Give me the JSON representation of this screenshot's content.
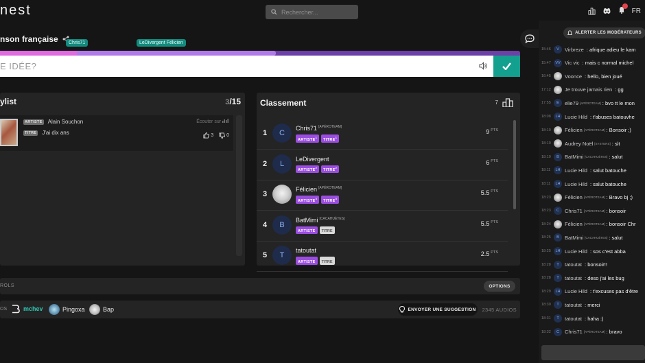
{
  "header": {
    "logo": "nest",
    "search_placeholder": "Rechercher...",
    "language": "FR"
  },
  "room": {
    "title": "nson française",
    "progress_fraction": 0.53,
    "player_tags": [
      "Chris71",
      "LeDivergent Félicien"
    ]
  },
  "answer": {
    "placeholder": "E IDÉE?"
  },
  "playlist": {
    "title": "ylist",
    "count_current": "3",
    "count_total": "/15",
    "song": {
      "artist_badge": "ARTISTE",
      "artist": "Alain Souchon",
      "title_badge": "TITRE",
      "title": "J'ai dix ans",
      "listen": "Écouter sur",
      "likes": "3",
      "dislikes": "0"
    }
  },
  "ranking": {
    "title": "Classement",
    "count": "7",
    "pts_label": "PTS",
    "rows": [
      {
        "rank": "1",
        "initial": "C",
        "name": "Chris71",
        "team": "[APÉROTEAM]",
        "badges": [
          {
            "label": "ARTISTE",
            "sup": "1",
            "active": true
          },
          {
            "label": "TITRE",
            "sup": "1",
            "active": true
          }
        ],
        "points": "9",
        "photo": false
      },
      {
        "rank": "2",
        "initial": "L",
        "name": "LeDivergent",
        "team": "",
        "badges": [
          {
            "label": "ARTISTE",
            "sup": "2",
            "active": true
          },
          {
            "label": "TITRE",
            "sup": "2",
            "active": true
          }
        ],
        "points": "6",
        "photo": false
      },
      {
        "rank": "3",
        "initial": "",
        "name": "Félicien",
        "team": "[APÉROTEAM]",
        "badges": [
          {
            "label": "ARTISTE",
            "sup": "3",
            "active": true
          },
          {
            "label": "TITRE",
            "sup": "3",
            "active": true
          }
        ],
        "points": "5.5",
        "photo": true
      },
      {
        "rank": "4",
        "initial": "B",
        "name": "BatMimi",
        "team": "[CACAHUÈTES]",
        "badges": [
          {
            "label": "ARTISTE",
            "sup": "",
            "active": true
          },
          {
            "label": "TITRE",
            "sup": "",
            "active": false
          }
        ],
        "points": "5.5",
        "photo": false
      },
      {
        "rank": "5",
        "initial": "T",
        "name": "tatoutat",
        "team": "",
        "badges": [
          {
            "label": "ARTISTE",
            "sup": "",
            "active": true
          },
          {
            "label": "TITRE",
            "sup": "",
            "active": false
          }
        ],
        "points": "2.5",
        "photo": false
      }
    ]
  },
  "bottom": {
    "controls_label": "ROLS",
    "options": "OPTIONS",
    "players_lead": "OS",
    "players": [
      "mchev",
      "Pingoxa",
      "Bap"
    ],
    "suggest": "ENVOYER UNE SUGGESTION",
    "audios": "2345 AUDIOS"
  },
  "chat": {
    "alert": "ALERTER LES MODÉRATEURS",
    "messages": [
      {
        "time": "15:46",
        "initial": "V",
        "user": "Virbreze",
        "team": "",
        "text": "afrique adieu le kam",
        "photo": false
      },
      {
        "time": "15:47",
        "initial": "VV",
        "user": "Vic vic",
        "team": "",
        "text": "mais c normal michel",
        "photo": false
      },
      {
        "time": "16:45",
        "initial": "",
        "user": "Voonce",
        "team": "",
        "text": "hello, bien joué",
        "photo": true
      },
      {
        "time": "17:12",
        "initial": "",
        "user": "Je trouve jamais rien",
        "team": "",
        "text": "gg",
        "photo": true
      },
      {
        "time": "17:55",
        "initial": "E",
        "user": "elie79",
        "team": "[APÉROTEAM]",
        "text": "bvo tt le mon",
        "photo": false
      },
      {
        "time": "18:08",
        "initial": "LH",
        "user": "Lucie Hild",
        "team": "",
        "text": "t'abuses batouvhe",
        "photo": false
      },
      {
        "time": "18:10",
        "initial": "",
        "user": "Félicien",
        "team": "[APÉROTEAM]",
        "text": "Bonsoir ;)",
        "photo": true
      },
      {
        "time": "18:10",
        "initial": "",
        "user": "Audrey Noël",
        "team": "[SYSTERS]",
        "text": "slt",
        "photo": true
      },
      {
        "time": "18:10",
        "initial": "B",
        "user": "BatMimi",
        "team": "[CACAHUÈTES]",
        "text": "salut",
        "photo": false
      },
      {
        "time": "18:11",
        "initial": "LH",
        "user": "Lucie Hild",
        "team": "",
        "text": "salut batouche",
        "photo": false
      },
      {
        "time": "18:11",
        "initial": "LH",
        "user": "Lucie Hild",
        "team": "",
        "text": "salut batouche",
        "photo": false
      },
      {
        "time": "18:23",
        "initial": "",
        "user": "Félicien",
        "team": "[APÉROTEAM]",
        "text": "Bravo bj ;)",
        "photo": true
      },
      {
        "time": "18:23",
        "initial": "C",
        "user": "Chris71",
        "team": "[APÉROTEAM]",
        "text": "bonsoir",
        "photo": false
      },
      {
        "time": "18:24",
        "initial": "",
        "user": "Félicien",
        "team": "[APÉROTEAM]",
        "text": "bonsoir Chr",
        "photo": true
      },
      {
        "time": "18:25",
        "initial": "B",
        "user": "BatMimi",
        "team": "[CACAHUÈTES]",
        "text": "salut",
        "photo": false
      },
      {
        "time": "18:25",
        "initial": "LH",
        "user": "Lucie Hild",
        "team": "",
        "text": "sos c'est abba",
        "photo": false
      },
      {
        "time": "18:28",
        "initial": "T",
        "user": "tatoutat",
        "team": "",
        "text": "bonsoir!!",
        "photo": false
      },
      {
        "time": "18:28",
        "initial": "T",
        "user": "tatoutat",
        "team": "",
        "text": "deso j'ai les bug",
        "photo": false
      },
      {
        "time": "18:29",
        "initial": "LH",
        "user": "Lucie Hild",
        "team": "",
        "text": "t'excuses pas d'être",
        "photo": false
      },
      {
        "time": "18:30",
        "initial": "T",
        "user": "tatoutat",
        "team": "",
        "text": "merci",
        "photo": false
      },
      {
        "time": "18:31",
        "initial": "T",
        "user": "tatoutat",
        "team": "",
        "text": "haha :)",
        "photo": false
      },
      {
        "time": "18:32",
        "initial": "C",
        "user": "Chris71",
        "team": "[APÉROTEAM]",
        "text": "bravo",
        "photo": false
      }
    ]
  }
}
